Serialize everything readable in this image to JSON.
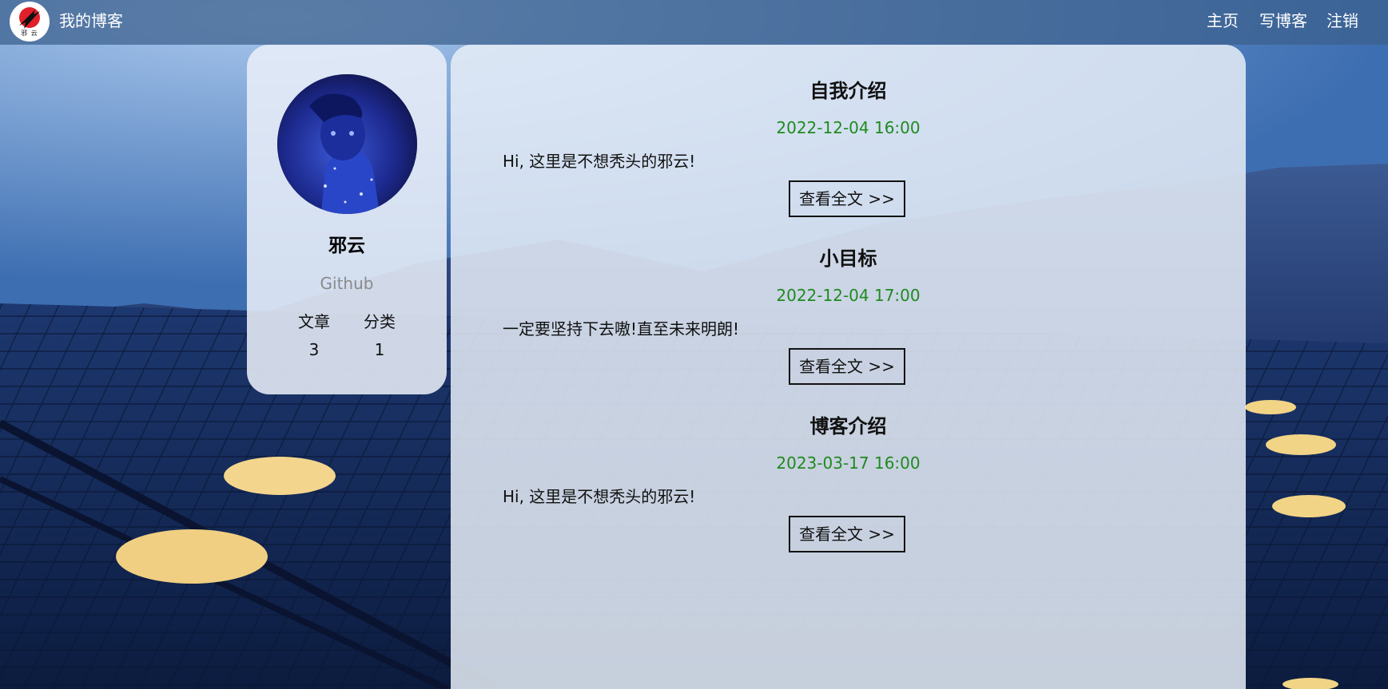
{
  "nav": {
    "logo_text": "邪 云",
    "brand": "我的博客",
    "links": [
      "主页",
      "写博客",
      "注销"
    ]
  },
  "profile": {
    "name": "邪云",
    "github": "Github",
    "stats": [
      {
        "label": "文章",
        "value": "3"
      },
      {
        "label": "分类",
        "value": "1"
      }
    ]
  },
  "posts": [
    {
      "title": "自我介绍",
      "date": "2022-12-04 16:00",
      "summary": "Hi, 这里是不想秃头的邪云!",
      "button": "查看全文 >>"
    },
    {
      "title": "小目标",
      "date": "2022-12-04 17:00",
      "summary": "一定要坚持下去嗷!直至未来明朗!",
      "button": "查看全文 >>"
    },
    {
      "title": "博客介绍",
      "date": "2023-03-17 16:00",
      "summary": "Hi, 这里是不想秃头的邪云!",
      "button": "查看全文 >>"
    }
  ],
  "colors": {
    "date": "#1f8a1f",
    "github": "#8a8a8a"
  }
}
